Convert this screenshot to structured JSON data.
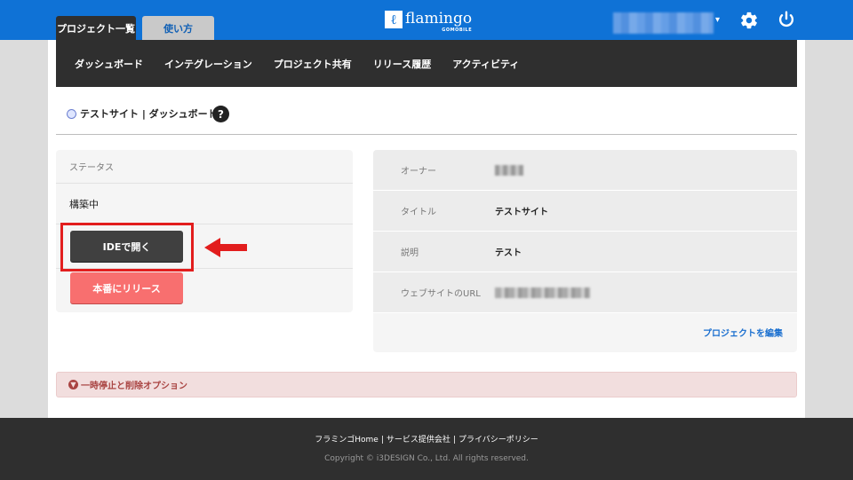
{
  "header": {
    "tabs": [
      {
        "label": "プロジェクト一覧",
        "active": true
      },
      {
        "label": "使い方",
        "active": false
      }
    ],
    "logo": {
      "name": "flamingo",
      "sub": "GOMOBILE"
    },
    "icons": {
      "gear": "gear-icon",
      "power": "power-icon",
      "caret": "▾"
    }
  },
  "subnav": {
    "items": [
      "ダッシュボード",
      "インテグレーション",
      "プロジェクト共有",
      "リリース履歴",
      "アクティビティ"
    ]
  },
  "breadcrumb": {
    "text": "テストサイト | ダッシュボード",
    "help": "?"
  },
  "status": {
    "heading": "ステータス",
    "value": "構築中",
    "open_ide_label": "IDEで開く",
    "release_label": "本番にリリース"
  },
  "info": {
    "rows": [
      {
        "label": "オーナー",
        "value": ""
      },
      {
        "label": "タイトル",
        "value": "テストサイト"
      },
      {
        "label": "説明",
        "value": "テスト"
      },
      {
        "label": "ウェブサイトのURL",
        "value": ""
      }
    ],
    "edit_link": "プロジェクトを編集"
  },
  "danger": {
    "label": "一時停止と削除オプション"
  },
  "footer": {
    "links": [
      "フラミンゴHome",
      "サービス提供会社",
      "プライバシーポリシー"
    ],
    "separator": "|",
    "copyright": "Copyright © i3DESIGN Co., Ltd. All rights reserved."
  },
  "colors": {
    "brand_blue": "#0f72d6",
    "dark": "#2f2f2f",
    "release_red": "#f86f6f",
    "highlight_red": "#e21d1d"
  }
}
